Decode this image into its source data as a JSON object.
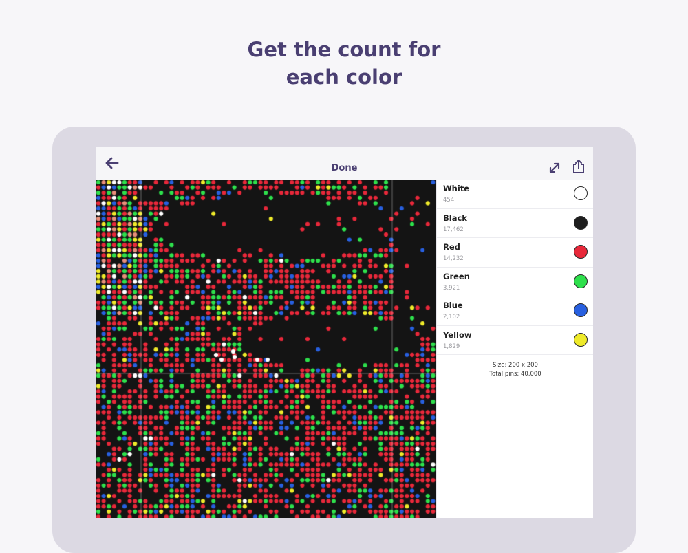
{
  "headline": {
    "line1": "Get the count for",
    "line2": "each color"
  },
  "nav": {
    "title": "Done",
    "back_icon": "arrow-left-icon",
    "expand_icon": "expand-icon",
    "share_icon": "share-icon"
  },
  "colors": [
    {
      "name": "White",
      "count": "454",
      "hex": "#ffffff"
    },
    {
      "name": "Black",
      "count": "17,462",
      "hex": "#1e1e1e"
    },
    {
      "name": "Red",
      "count": "14,232",
      "hex": "#e8283a"
    },
    {
      "name": "Green",
      "count": "3,921",
      "hex": "#2ee04c"
    },
    {
      "name": "Blue",
      "count": "2,102",
      "hex": "#2860e0"
    },
    {
      "name": "Yellow",
      "count": "1,829",
      "hex": "#eeea2a"
    }
  ],
  "summary": {
    "size": "Size: 200 x 200",
    "total": "Total pins: 40,000"
  },
  "theme": {
    "accent": "#4a3f72",
    "frame": "#dcd9e3",
    "background": "#f7f6f9"
  }
}
